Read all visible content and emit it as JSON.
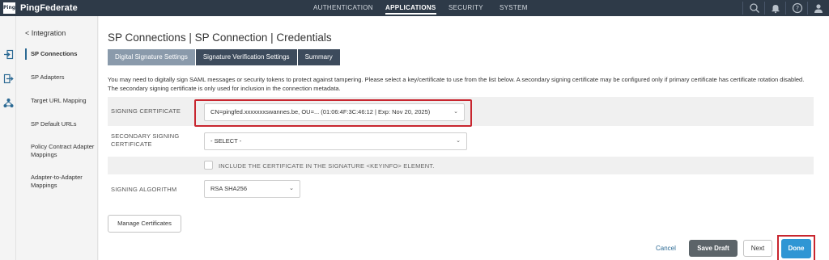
{
  "app": {
    "logo_mark": "Ping",
    "name": "PingFederate"
  },
  "topnav": {
    "items": [
      {
        "label": "AUTHENTICATION",
        "active": false
      },
      {
        "label": "APPLICATIONS",
        "active": true
      },
      {
        "label": "SECURITY",
        "active": false
      },
      {
        "label": "SYSTEM",
        "active": false
      }
    ],
    "icons": [
      "search-icon",
      "bell-icon",
      "help-icon",
      "user-icon"
    ]
  },
  "iconstrip": {
    "icons": [
      "sign-in-icon",
      "sign-out-icon",
      "network-icon"
    ]
  },
  "sidebar": {
    "back_label": "< Integration",
    "items": [
      {
        "label": "SP Connections",
        "active": true
      },
      {
        "label": "SP Adapters",
        "active": false
      },
      {
        "label": "Target URL Mapping",
        "active": false
      },
      {
        "label": "SP Default URLs",
        "active": false
      },
      {
        "label": "Policy Contract Adapter Mappings",
        "active": false
      },
      {
        "label": "Adapter-to-Adapter Mappings",
        "active": false
      }
    ]
  },
  "main": {
    "title": "SP Connections | SP Connection | Credentials",
    "tabs": [
      {
        "label": "Digital Signature Settings",
        "active": true
      },
      {
        "label": "Signature Verification Settings",
        "active": false
      },
      {
        "label": "Summary",
        "active": false
      }
    ],
    "description_line1": "You may need to digitally sign SAML messages or security tokens to protect against tampering. Please select a key/certificate to use from the list below. A secondary signing certificate may be configured only if primary certificate has certificate rotation disabled.",
    "description_line2": "The secondary signing certificate is only used for inclusion in the connection metadata.",
    "fields": {
      "signing_certificate": {
        "label": "SIGNING CERTIFICATE",
        "value": "CN=pingfed.xxxxxxxswannes.be, OU=... (01:06:4F:3C:46:12 | Exp: Nov 20, 2025)"
      },
      "secondary_certificate": {
        "label": "SECONDARY SIGNING CERTIFICATE",
        "value": "- SELECT -"
      },
      "include_cert": {
        "label": "INCLUDE THE CERTIFICATE IN THE SIGNATURE <KEYINFO> ELEMENT.",
        "checked": false
      },
      "signing_algorithm": {
        "label": "SIGNING ALGORITHM",
        "value": "RSA SHA256"
      }
    },
    "manage_button": "Manage Certificates"
  },
  "footer": {
    "cancel": "Cancel",
    "save_draft": "Save Draft",
    "next": "Next",
    "done": "Done"
  },
  "colors": {
    "topbar": "#2e3a48",
    "accent": "#2f96d4",
    "highlight": "#c8262f"
  }
}
